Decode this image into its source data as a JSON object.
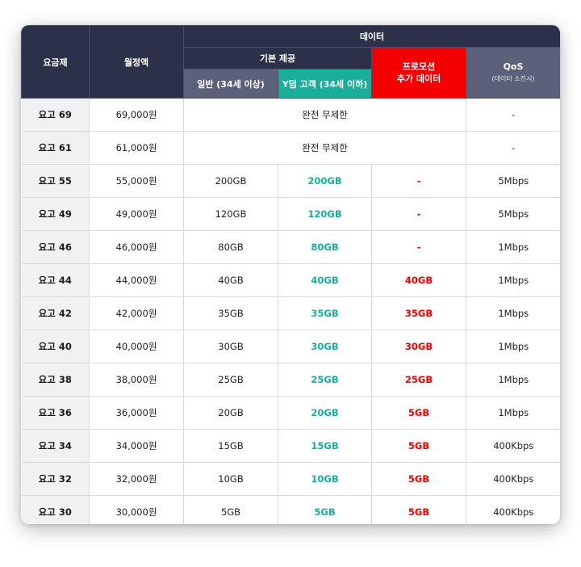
{
  "header": {
    "plan": "요금제",
    "price": "월정액",
    "data": "데이터",
    "basic": "기본 제공",
    "general": "일반 (34세 이상)",
    "ydum": "Y덤 고객 (34세 이하)",
    "promo_line1": "프로모션",
    "promo_line2": "추가 데이터",
    "qos": "QoS",
    "qos_note": "(데이터 소진시)"
  },
  "rows": [
    {
      "plan": "요고 69",
      "price": "69,000원",
      "unlimited": "완전 무제한",
      "qos": "-"
    },
    {
      "plan": "요고 61",
      "price": "61,000원",
      "unlimited": "완전 무제한",
      "qos": "-"
    },
    {
      "plan": "요고 55",
      "price": "55,000원",
      "general": "200GB",
      "ydum": "200GB",
      "promo": "-",
      "qos": "5Mbps"
    },
    {
      "plan": "요고 49",
      "price": "49,000원",
      "general": "120GB",
      "ydum": "120GB",
      "promo": "-",
      "qos": "5Mbps"
    },
    {
      "plan": "요고 46",
      "price": "46,000원",
      "general": "80GB",
      "ydum": "80GB",
      "promo": "-",
      "qos": "1Mbps"
    },
    {
      "plan": "요고 44",
      "price": "44,000원",
      "general": "40GB",
      "ydum": "40GB",
      "promo": "40GB",
      "qos": "1Mbps"
    },
    {
      "plan": "요고 42",
      "price": "42,000원",
      "general": "35GB",
      "ydum": "35GB",
      "promo": "35GB",
      "qos": "1Mbps"
    },
    {
      "plan": "요고 40",
      "price": "40,000원",
      "general": "30GB",
      "ydum": "30GB",
      "promo": "30GB",
      "qos": "1Mbps"
    },
    {
      "plan": "요고 38",
      "price": "38,000원",
      "general": "25GB",
      "ydum": "25GB",
      "promo": "25GB",
      "qos": "1Mbps"
    },
    {
      "plan": "요고 36",
      "price": "36,000원",
      "general": "20GB",
      "ydum": "20GB",
      "promo": "5GB",
      "qos": "1Mbps"
    },
    {
      "plan": "요고 34",
      "price": "34,000원",
      "general": "15GB",
      "ydum": "15GB",
      "promo": "5GB",
      "qos": "400Kbps"
    },
    {
      "plan": "요고 32",
      "price": "32,000원",
      "general": "10GB",
      "ydum": "10GB",
      "promo": "5GB",
      "qos": "400Kbps"
    },
    {
      "plan": "요고 30",
      "price": "30,000원",
      "general": "5GB",
      "ydum": "5GB",
      "promo": "5GB",
      "qos": "400Kbps"
    }
  ],
  "colors": {
    "header_dark": "#2d3049",
    "header_sub": "#5d6079",
    "ydum_teal": "#1aae9a",
    "promo_red": "#f40000",
    "plan_bg": "#f1f1f3"
  }
}
